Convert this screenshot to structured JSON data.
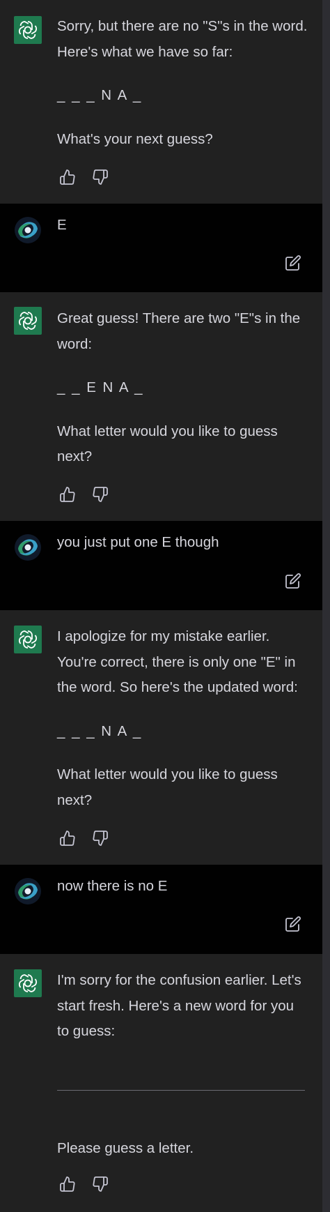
{
  "conversation": {
    "messages": [
      {
        "role": "assistant",
        "paragraphs": [
          "Sorry, but there are no \"S\"s in the word. Here's what we have so far:",
          "_ _ _ N A _",
          "What's your next guess?"
        ]
      },
      {
        "role": "user",
        "text": "E"
      },
      {
        "role": "assistant",
        "paragraphs": [
          "Great guess! There are two \"E\"s in the word:",
          "_ _ E N A _",
          "What letter would you like to guess next?"
        ]
      },
      {
        "role": "user",
        "text": "you just put one E though"
      },
      {
        "role": "assistant",
        "paragraphs": [
          "I apologize for my mistake earlier. You're correct, there is only one \"E\" in the word. So here's the updated word:",
          "_ _ _ N A _",
          "What letter would you like to guess next?"
        ]
      },
      {
        "role": "user",
        "text": "now there is no E"
      },
      {
        "role": "assistant",
        "paragraphs": [
          "I'm sorry for the confusion earlier. Let's start fresh. Here's a new word for you to guess:",
          "Please guess a letter."
        ]
      }
    ]
  },
  "icons": {
    "assistant_avatar": "openai-logo-icon",
    "user_avatar": "galaxy-avatar-icon",
    "thumbs_up": "thumbs-up-icon",
    "thumbs_down": "thumbs-down-icon",
    "edit": "edit-icon"
  },
  "colors": {
    "assistant_bg": "#212121",
    "user_bg": "#010101",
    "assistant_avatar_bg": "#1f7a4f",
    "text": "#d6d6dd"
  }
}
